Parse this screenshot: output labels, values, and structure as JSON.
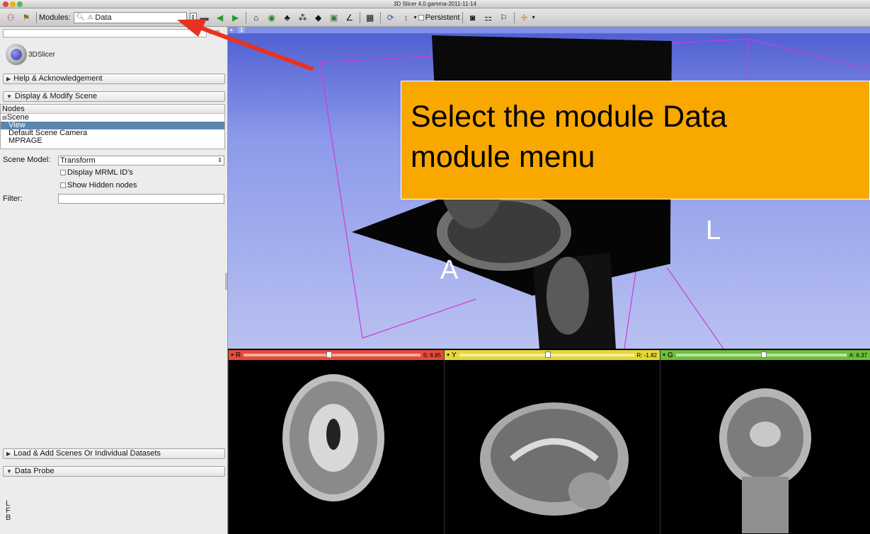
{
  "window": {
    "title": "3D Slicer 4.0.gamma-2011-11-14"
  },
  "toolbar": {
    "modules_label": "Modules:",
    "module_selected": "Data",
    "persistent_label": "Persistent"
  },
  "left_panel": {
    "logo_text": "3DSlicer",
    "sections": {
      "help": "Help & Acknowledgement",
      "display_modify": "Display & Modify Scene",
      "load_add": "Load & Add Scenes Or Individual Datasets",
      "data_probe": "Data Probe"
    },
    "tree": {
      "header": "Nodes",
      "root": "Scene",
      "items": [
        "View",
        "Default Scene Camera",
        "MPRAGE"
      ],
      "selected": "View"
    },
    "scene_model_label": "Scene Model:",
    "scene_model_value": "Transform",
    "checkboxes": [
      "Display MRML ID's",
      "Show Hidden nodes"
    ],
    "filter_label": "Filter:",
    "filter_value": "",
    "probe_lines": [
      "L",
      "F",
      "B"
    ]
  },
  "view3d": {
    "view_number": "1",
    "orientation_labels": {
      "left": "L",
      "anterior": "A"
    }
  },
  "overlay": {
    "line1": "Select the module Data",
    "line2": "module menu"
  },
  "slices": [
    {
      "letter": "R",
      "offset": "S: 8.85",
      "color": "#e74a3a",
      "slider_fraction": 0.47
    },
    {
      "letter": "Y",
      "offset": "R: -1.82",
      "color": "#e6d736",
      "slider_fraction": 0.49
    },
    {
      "letter": "G",
      "offset": "A: 6.37",
      "color": "#6bbf3b",
      "slider_fraction": 0.5
    }
  ]
}
